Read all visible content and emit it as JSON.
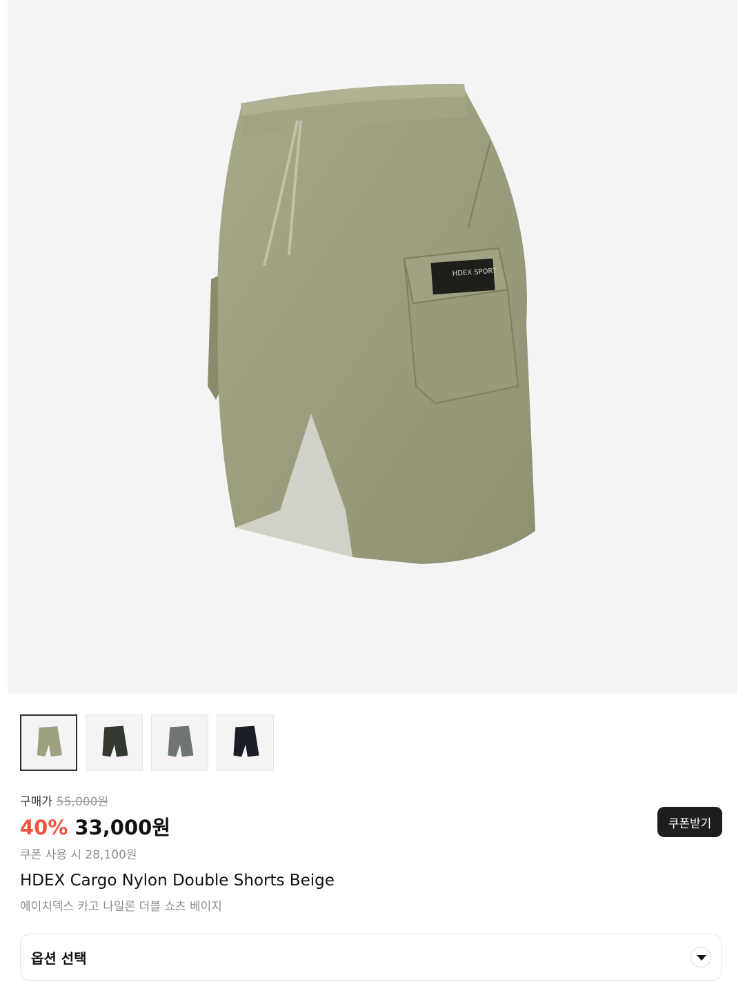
{
  "product": {
    "image_alt": "HDEX Cargo Nylon Double Shorts Beige",
    "label_text": "HDEX SPORT",
    "thumbnails": [
      {
        "color": "#9fa07f",
        "selected": true
      },
      {
        "color": "#323a2f",
        "selected": false
      },
      {
        "color": "#6e7572",
        "selected": false
      },
      {
        "color": "#1b1e27",
        "selected": false
      }
    ],
    "price": {
      "label": "구매가",
      "original": "55,000원",
      "discount": "40%",
      "sale": "33,000원",
      "coupon_text": "쿠폰 사용 시 28,100원"
    },
    "coupon_button": "쿠폰받기",
    "title_en": "HDEX Cargo Nylon Double Shorts Beige",
    "title_ko": "에이치덱스 카고 나일론 더블 쇼츠 베이지",
    "option_label": "옵션 선택"
  },
  "colors": {
    "discount": "#f0533d",
    "button_bg": "#1e1e1e",
    "hero_bg": "#f4f4f4"
  }
}
